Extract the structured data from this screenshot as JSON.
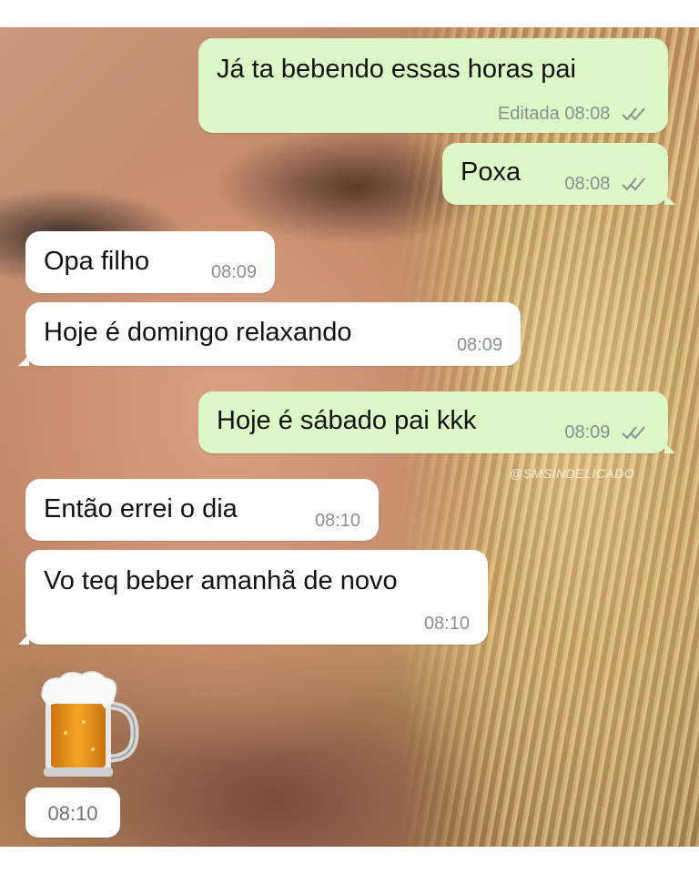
{
  "chat": {
    "messages": [
      {
        "direction": "out",
        "text": "Já ta bebendo essas horas pai",
        "edited_label": "Editada",
        "time": "08:08",
        "status": "read"
      },
      {
        "direction": "out",
        "text": "Poxa",
        "time": "08:08",
        "status": "read"
      },
      {
        "direction": "in",
        "text": "Opa filho",
        "time": "08:09"
      },
      {
        "direction": "in",
        "text": "Hoje é domingo relaxando",
        "time": "08:09"
      },
      {
        "direction": "out",
        "text": "Hoje é sábado pai kkk",
        "time": "08:09",
        "status": "read"
      },
      {
        "direction": "in",
        "text": "Então errei o dia",
        "time": "08:10"
      },
      {
        "direction": "in",
        "text": "Vo teq beber amanhã de novo",
        "time": "08:10"
      },
      {
        "direction": "in",
        "type": "emoji",
        "emoji": "beer-mug-icon",
        "time": "08:10"
      }
    ]
  },
  "watermark": "@SMSINDELICADO",
  "colors": {
    "outgoing_bubble": "#dcf8c6",
    "incoming_bubble": "#ffffff",
    "meta_text": "#8a8f92"
  }
}
